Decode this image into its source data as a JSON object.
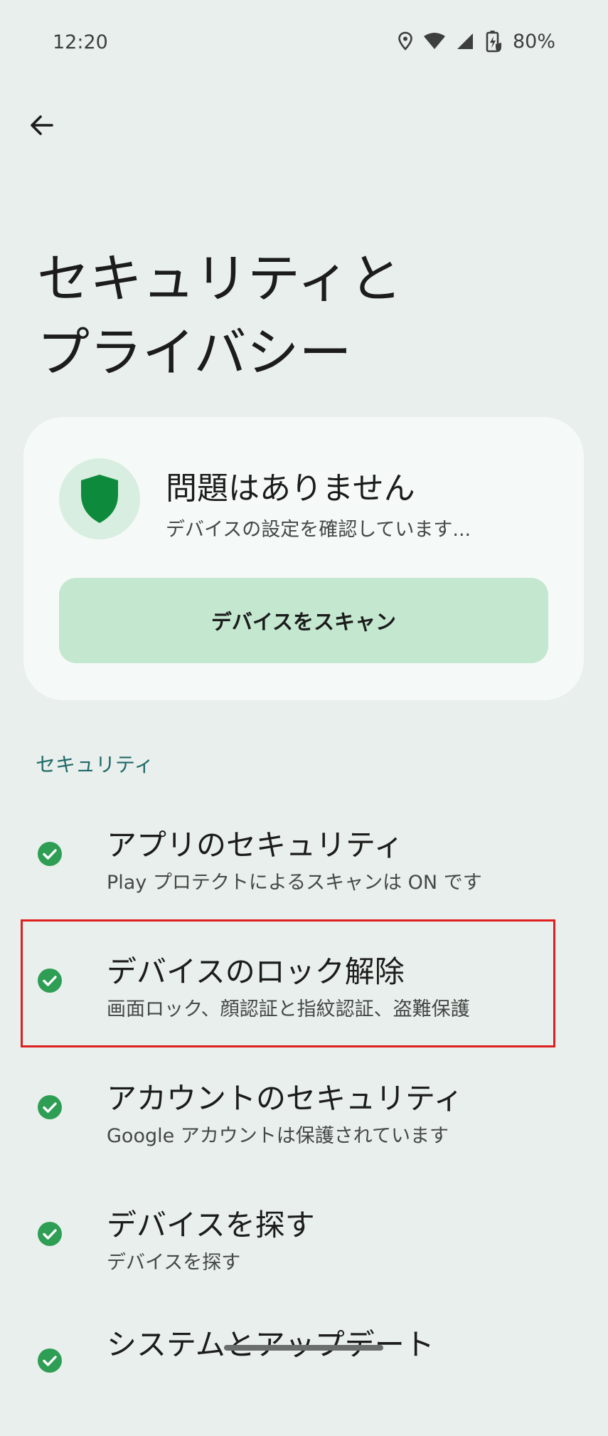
{
  "status_bar": {
    "time": "12:20",
    "battery": "80%",
    "icons": [
      "location-icon",
      "wifi-icon",
      "signal-icon",
      "battery-charging-icon"
    ]
  },
  "header": {
    "back_icon": "arrow-back-icon",
    "title_line1": "セキュリティと",
    "title_line2": "プライバシー"
  },
  "status_card": {
    "icon": "shield-icon",
    "title": "問題はありません",
    "subtitle": "デバイスの設定を確認しています...",
    "scan_button": "デバイスをスキャン"
  },
  "security_section": {
    "header": "セキュリティ",
    "items": [
      {
        "title": "アプリのセキュリティ",
        "subtitle": "Play プロテクトによるスキャンは ON です",
        "status_icon": "check-circle-icon"
      },
      {
        "title": "デバイスのロック解除",
        "subtitle": "画面ロック、顔認証と指紋認証、盗難保護",
        "status_icon": "check-circle-icon"
      },
      {
        "title": "アカウントのセキュリティ",
        "subtitle": "Google アカウントは保護されています",
        "status_icon": "check-circle-icon"
      },
      {
        "title": "デバイスを探す",
        "subtitle": "デバイスを探す",
        "status_icon": "check-circle-icon"
      },
      {
        "title": "システムとアップデート",
        "subtitle": "",
        "status_icon": "check-circle-icon"
      }
    ]
  },
  "colors": {
    "background": "#e9efec",
    "card": "#f5faf8",
    "accent_green": "#0d8a3c",
    "scan_button": "#c4e7d0",
    "section_header": "#1f6a68",
    "highlight_border": "#dd1f1f"
  }
}
